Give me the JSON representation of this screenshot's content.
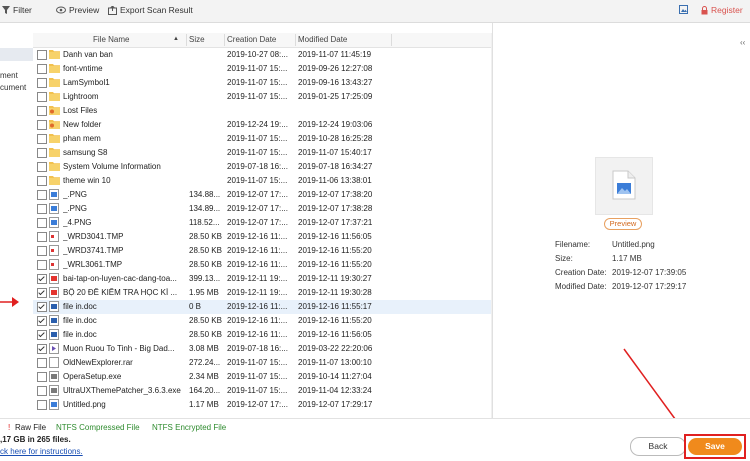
{
  "toolbar": {
    "filter_label": "Filter",
    "preview_label": "Preview",
    "export_label": "Export Scan Result",
    "register_label": "Register"
  },
  "left_panel": {
    "items": [
      "ment",
      "cument"
    ]
  },
  "table": {
    "headers": {
      "name": "File Name",
      "size": "Size",
      "created": "Creation Date",
      "modified": "Modified Date"
    },
    "rows": [
      {
        "checked": false,
        "icon": "folder-icon",
        "name": "Danh van ban",
        "size": "",
        "created": "2019-10-27 08:...",
        "modified": "2019-11-07 11:45:19"
      },
      {
        "checked": false,
        "icon": "folder-icon",
        "name": "font-vntime",
        "size": "",
        "created": "2019-11-07 15:...",
        "modified": "2019-09-26 12:27:08"
      },
      {
        "checked": false,
        "icon": "folder-icon",
        "name": "LamSymbol1",
        "size": "",
        "created": "2019-11-07 15:...",
        "modified": "2019-09-16 13:43:27"
      },
      {
        "checked": false,
        "icon": "folder-icon",
        "name": "Lightroom",
        "size": "",
        "created": "2019-11-07 15:...",
        "modified": "2019-01-25 17:25:09"
      },
      {
        "checked": false,
        "icon": "lost-folder-icon",
        "name": "Lost Files",
        "size": "",
        "created": "",
        "modified": ""
      },
      {
        "checked": false,
        "icon": "lost-folder-icon",
        "name": "New folder",
        "size": "",
        "created": "2019-12-24 19:...",
        "modified": "2019-12-24 19:03:06"
      },
      {
        "checked": false,
        "icon": "folder-icon",
        "name": "phan mem",
        "size": "",
        "created": "2019-11-07 15:...",
        "modified": "2019-10-28 16:25:28"
      },
      {
        "checked": false,
        "icon": "folder-icon",
        "name": "samsung S8",
        "size": "",
        "created": "2019-11-07 15:...",
        "modified": "2019-11-07 15:40:17"
      },
      {
        "checked": false,
        "icon": "folder-icon",
        "name": "System Volume Information",
        "size": "",
        "created": "2019-07-18 16:...",
        "modified": "2019-07-18 16:34:27"
      },
      {
        "checked": false,
        "icon": "folder-icon",
        "name": "theme win 10",
        "size": "",
        "created": "2019-11-07 15:...",
        "modified": "2019-11-06 13:38:01"
      },
      {
        "checked": false,
        "icon": "image-file-icon",
        "name": "_.PNG",
        "size": "134.88...",
        "created": "2019-12-07 17:...",
        "modified": "2019-12-07 17:38:20"
      },
      {
        "checked": false,
        "icon": "image-file-icon",
        "name": "_.PNG",
        "size": "134.89...",
        "created": "2019-12-07 17:...",
        "modified": "2019-12-07 17:38:28"
      },
      {
        "checked": false,
        "icon": "image-file-icon",
        "name": "_4.PNG",
        "size": "118.52...",
        "created": "2019-12-07 17:...",
        "modified": "2019-12-07 17:37:21"
      },
      {
        "checked": false,
        "icon": "tmp-file-icon",
        "name": "_WRD3041.TMP",
        "size": "28.50 KB",
        "created": "2019-12-16 11:...",
        "modified": "2019-12-16 11:56:05"
      },
      {
        "checked": false,
        "icon": "tmp-file-icon",
        "name": "_WRD3741.TMP",
        "size": "28.50 KB",
        "created": "2019-12-16 11:...",
        "modified": "2019-12-16 11:55:20"
      },
      {
        "checked": false,
        "icon": "tmp-file-icon",
        "name": "_WRL3061.TMP",
        "size": "28.50 KB",
        "created": "2019-12-16 11:...",
        "modified": "2019-12-16 11:55:20"
      },
      {
        "checked": true,
        "icon": "pdf-file-icon",
        "name": "bai-tap-on-luyen-cac-dang-toa...",
        "size": "399.13...",
        "created": "2019-12-11 19:...",
        "modified": "2019-12-11 19:30:27"
      },
      {
        "checked": true,
        "icon": "pdf-file-icon",
        "name": "BỘ 20 ĐỀ KIỂM TRA HỌC KÌ ...",
        "size": "1.95 MB",
        "created": "2019-12-11 19:...",
        "modified": "2019-12-11 19:30:28"
      },
      {
        "checked": true,
        "icon": "doc-file-icon",
        "name": "file in.doc",
        "size": "0 B",
        "created": "2019-12-16 11:...",
        "modified": "2019-12-16 11:55:17",
        "highlight": true
      },
      {
        "checked": true,
        "icon": "doc-file-icon",
        "name": "file in.doc",
        "size": "28.50 KB",
        "created": "2019-12-16 11:...",
        "modified": "2019-12-16 11:55:20"
      },
      {
        "checked": true,
        "icon": "doc-file-icon",
        "name": "file in.doc",
        "size": "28.50 KB",
        "created": "2019-12-16 11:...",
        "modified": "2019-12-16 11:56:05"
      },
      {
        "checked": true,
        "icon": "video-file-icon",
        "name": "Muon Ruou To Tinh - Big Dad...",
        "size": "3.08 MB",
        "created": "2019-07-18 16:...",
        "modified": "2019-03-22 22:20:06"
      },
      {
        "checked": false,
        "icon": "file-icon",
        "name": "OldNewExplorer.rar",
        "size": "272.24...",
        "created": "2019-11-07 15:...",
        "modified": "2019-11-07 13:00:10"
      },
      {
        "checked": false,
        "icon": "exe-file-icon",
        "name": "OperaSetup.exe",
        "size": "2.34 MB",
        "created": "2019-11-07 15:...",
        "modified": "2019-10-14 11:27:04"
      },
      {
        "checked": false,
        "icon": "exe-file-icon",
        "name": "UltraUXThemePatcher_3.6.3.exe",
        "size": "164.20...",
        "created": "2019-11-07 15:...",
        "modified": "2019-11-04 12:33:24"
      },
      {
        "checked": false,
        "icon": "image-file-icon",
        "name": "Untitled.png",
        "size": "1.17 MB",
        "created": "2019-12-07 17:...",
        "modified": "2019-12-07 17:29:17"
      }
    ]
  },
  "preview": {
    "button_label": "Preview",
    "filename_label": "Filename:",
    "filename_value": "Untitled.png",
    "size_label": "Size:",
    "size_value": "1.17 MB",
    "created_label": "Creation Date:",
    "created_value": "2019-12-07 17:39:05",
    "modified_label": "Modified Date:",
    "modified_value": "2019-12-07 17:29:17"
  },
  "legend": {
    "raw_label": "Raw File",
    "compressed_label": "NTFS Compressed File",
    "encrypted_label": "NTFS Encrypted File",
    "compressed_color": "#2e8b2e",
    "encrypted_color": "#2e8b2e",
    "raw_marker_color": "#e02020"
  },
  "status": {
    "summary": ",17 GB in 265 files.",
    "help_link": "ck here for instructions."
  },
  "buttons": {
    "back_label": "Back",
    "save_label": "Save"
  },
  "colors": {
    "accent": "#f08a1c",
    "highlight_row": "#e8f1fb",
    "annotation_red": "#e02020"
  }
}
